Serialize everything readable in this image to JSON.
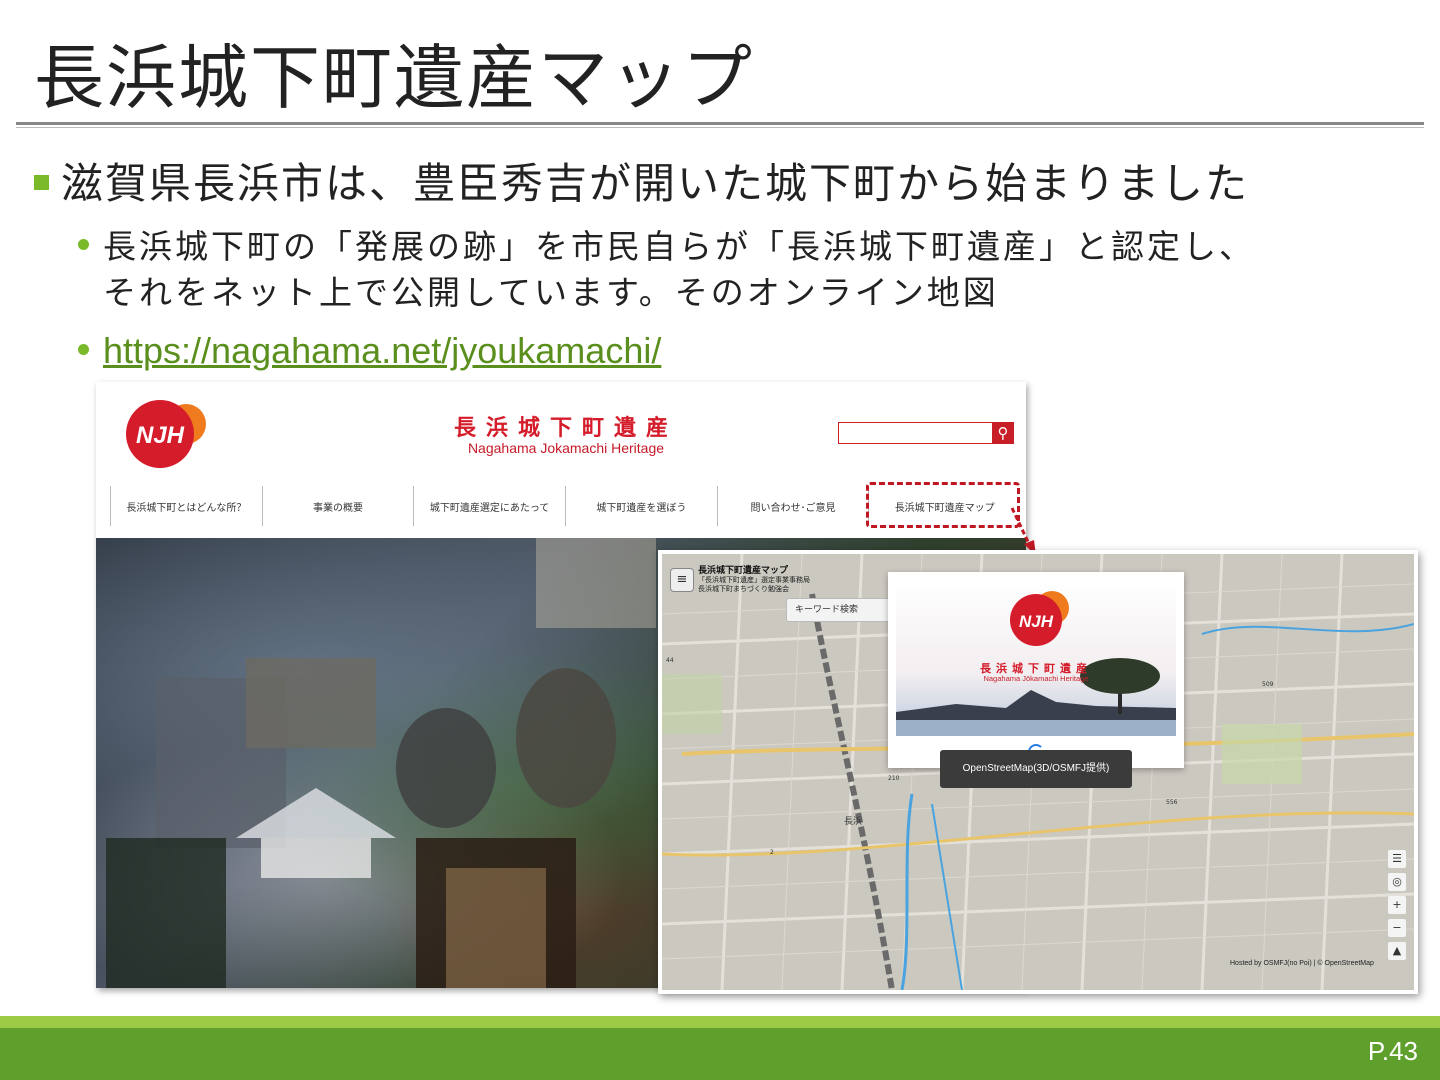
{
  "slide": {
    "title": "長浜城下町遺産マップ",
    "bullet1": "滋賀県長浜市は、豊臣秀吉が開いた城下町から始まりました",
    "bullet2_line1": "長浜城下町の「発展の跡」を市民自らが「長浜城下町遺産」と認定し、",
    "bullet2_line2": "それをネット上で公開しています。そのオンライン地図",
    "link": "https://nagahama.net/jyoukamachi/",
    "page_number": "P.43"
  },
  "website": {
    "logo_text": "NJH",
    "title": "長浜城下町遺産",
    "subtitle": "Nagahama Jokamachi Heritage",
    "search_icon": "magnifier-icon",
    "nav": [
      "長浜城下町とはどんな所？",
      "事業の概要",
      "城下町遺産選定にあたって",
      "城下町遺産を選ぼう",
      "問い合わせ･ご意見",
      "長浜城下町遺産マップ"
    ]
  },
  "map": {
    "header_title": "長浜城下町遺産マップ",
    "header_line2": "「長浜城下町遺産」選定事業事務局",
    "header_line3": "長浜城下町まちづくり勉強会",
    "menu_icon": "≡",
    "keyword_placeholder": "キーワード検索",
    "splash_title": "長浜城下町遺産",
    "splash_subtitle": "Nagahama Jōkamachi Heritage",
    "osm_button": "OpenStreetMap(3D/OSMFJ提供)",
    "place_label": "長浜",
    "road_numbers": [
      "509",
      "210",
      "556",
      "2",
      "44"
    ],
    "controls": [
      "layers-icon",
      "locate-icon",
      "+",
      "−",
      "compass-icon"
    ],
    "attribution": "Hosted by OSMFJ(no Poi) | © OpenStreetMap"
  },
  "colors": {
    "accent_green": "#7ab929",
    "footer_green": "#5f9f2c",
    "brand_red": "#d41c2a"
  }
}
